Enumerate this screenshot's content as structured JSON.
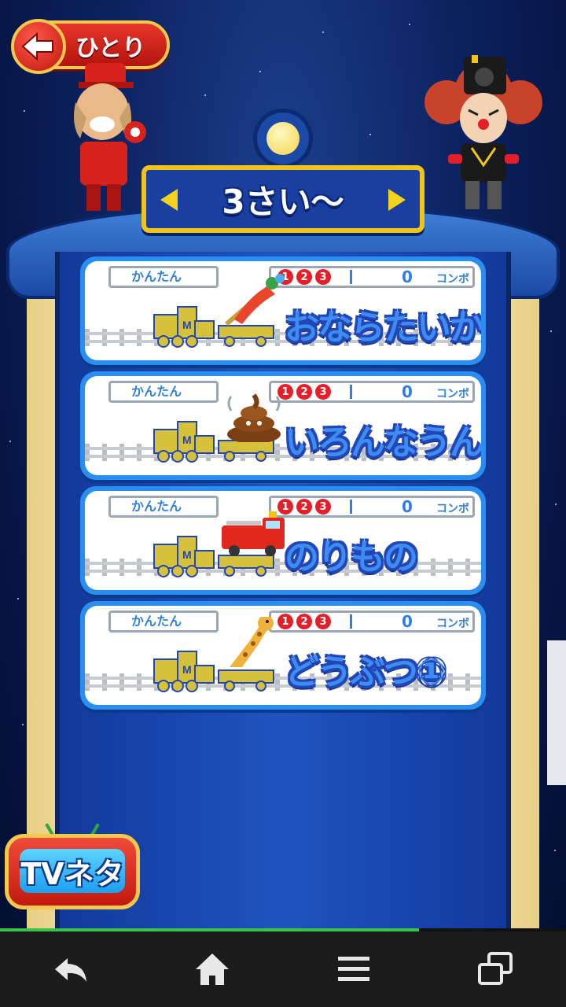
{
  "header": {
    "back_label": "ひとり"
  },
  "category": {
    "title": "3さい〜"
  },
  "games": [
    {
      "title": "おならたいかい",
      "difficulty": "かんたん",
      "digits": [
        "1",
        "2",
        "3"
      ],
      "combo_count": "0",
      "combo_label": "コンボ",
      "cargo_icon": "fart-gas-icon"
    },
    {
      "title": "いろんなうんち",
      "difficulty": "かんたん",
      "digits": [
        "1",
        "2",
        "3"
      ],
      "combo_count": "0",
      "combo_label": "コンボ",
      "cargo_icon": "poop-icon"
    },
    {
      "title": "のりもの",
      "difficulty": "かんたん",
      "digits": [
        "1",
        "2",
        "3"
      ],
      "combo_count": "0",
      "combo_label": "コンボ",
      "cargo_icon": "fire-truck-icon"
    },
    {
      "title": "どうぶつ①",
      "difficulty": "かんたん",
      "digits": [
        "1",
        "2",
        "3"
      ],
      "combo_count": "0",
      "combo_label": "コンボ",
      "cargo_icon": "giraffe-icon"
    }
  ],
  "tv_button": {
    "label": "TVネタ"
  },
  "progress": {
    "fraction": 0.74
  },
  "colors": {
    "accent_blue": "#3d8cf0",
    "frame_blue": "#1b3fa0",
    "gold": "#f2c418",
    "red": "#e51f2a"
  },
  "navbar": {
    "icons": [
      "back-icon",
      "home-icon",
      "menu-icon",
      "recent-apps-icon"
    ]
  }
}
